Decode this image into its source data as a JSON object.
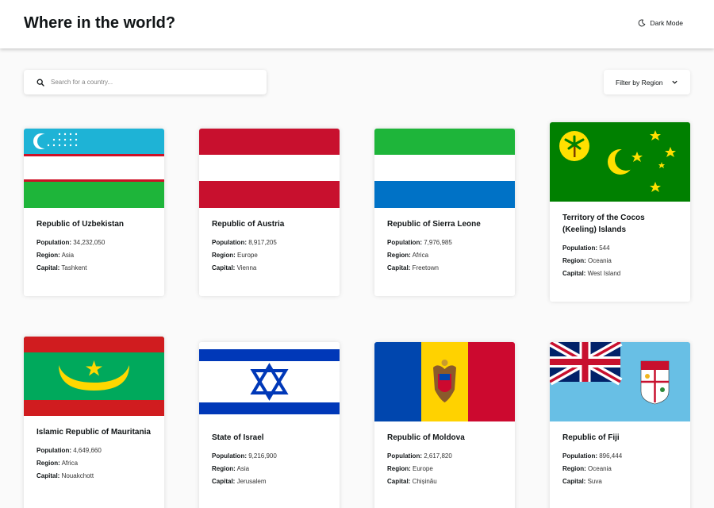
{
  "header": {
    "title": "Where in the world?",
    "dark_mode_label": "Dark Mode"
  },
  "search": {
    "placeholder": "Search for a country...",
    "value": ""
  },
  "filter": {
    "label": "Filter by Region"
  },
  "labels": {
    "population": "Population:",
    "region": "Region:",
    "capital": "Capital:"
  },
  "countries": [
    {
      "name": "Republic of Uzbekistan",
      "population": "34,232,050",
      "region": "Asia",
      "capital": "Tashkent"
    },
    {
      "name": "Republic of Austria",
      "population": "8,917,205",
      "region": "Europe",
      "capital": "Vienna"
    },
    {
      "name": "Republic of Sierra Leone",
      "population": "7,976,985",
      "region": "Africa",
      "capital": "Freetown"
    },
    {
      "name": "Territory of the Cocos (Keeling) Islands",
      "population": "544",
      "region": "Oceania",
      "capital": "West Island"
    },
    {
      "name": "Islamic Republic of Mauritania",
      "population": "4,649,660",
      "region": "Africa",
      "capital": "Nouakchott"
    },
    {
      "name": "State of Israel",
      "population": "9,216,900",
      "region": "Asia",
      "capital": "Jerusalem"
    },
    {
      "name": "Republic of Moldova",
      "population": "2,617,820",
      "region": "Europe",
      "capital": "Chișinău"
    },
    {
      "name": "Republic of Fiji",
      "population": "896,444",
      "region": "Oceania",
      "capital": "Suva"
    }
  ],
  "colors": {
    "background": "#fafafa",
    "card": "#ffffff",
    "text": "#111517"
  }
}
